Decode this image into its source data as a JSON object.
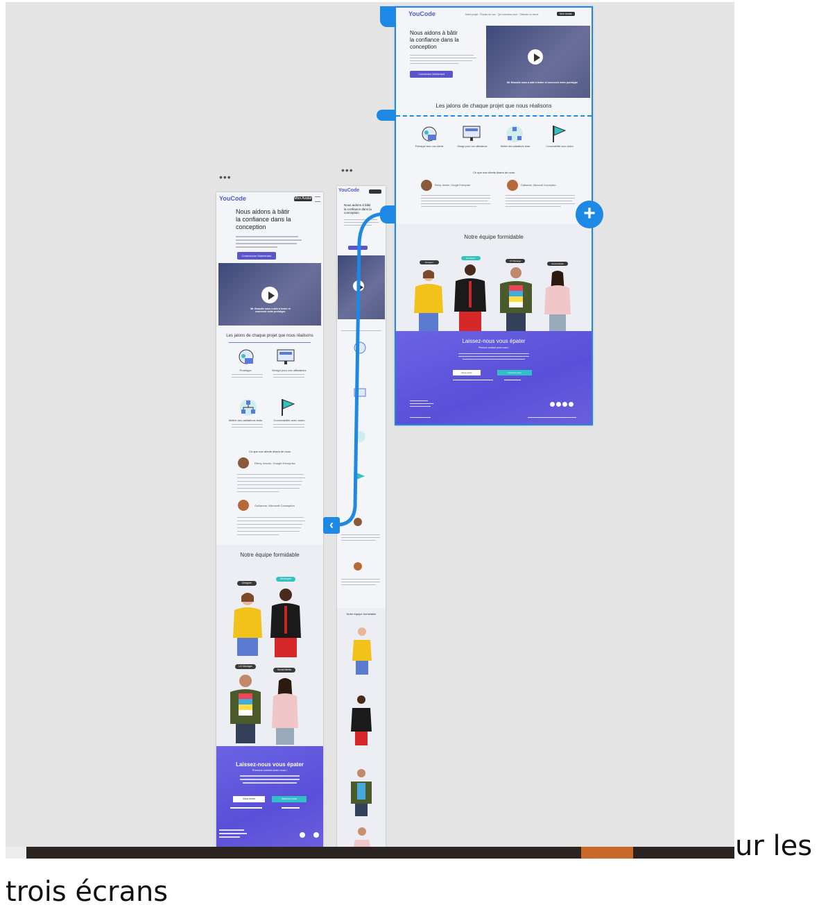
{
  "caption": {
    "line1": "ur les",
    "line2": "trois écrans"
  },
  "frame_menu_icon": "•••",
  "brand": {
    "logo": "YouCode",
    "accent": "#5a55c9",
    "teal": "#31c0c7",
    "selection": "#1e88e5"
  },
  "mobile": {
    "nav_button": "Mon Avatar",
    "hero_title": [
      "Nous aidons à bâtir",
      "la confiance dans la",
      "conception"
    ],
    "cta": "Commencer Maintenant",
    "video_caption": [
      "Mr. Beaudin nous a aidé à tester et",
      "concevoir notre prototype."
    ],
    "milestones_title": "Les jalons de chaque projet que nous réalisons",
    "features": [
      "Prototype",
      "Design pour vos utilisateurs",
      "Mettre des validations tests",
      "Concevabilité avec vision"
    ],
    "testimonials_title": "Ce que nos clients disent de nous",
    "testimonial1_name": "Rémy Janvier, Google Entreprise",
    "testimonial2_name": "Guillaume, Microsoft Conception",
    "team_title": "Notre équipe formidable",
    "team_tags": [
      "Designer",
      "Developer",
      "UX Manager",
      "Social Media"
    ],
    "cta_title": "Laissez-nous vous épater",
    "cta_subtitle": "Prenons contact avec nous !",
    "btn_primary": "Nous écrire",
    "btn_secondary": "Inscrivez-vous"
  },
  "tablet": {
    "hero_title": [
      "Nous aidons à bâtir",
      "la confiance dans la",
      "conception"
    ],
    "team_title": "Notre équipe formidable"
  },
  "desktop": {
    "nav_links": "Notre projet · Études de cas · Qui sommes-nous · Obtenez un devis",
    "nav_button": "Mon Avatar",
    "hero_title": [
      "Nous aidons à bâtir",
      "la confiance dans la",
      "conception"
    ],
    "cta": "Commencer Maintenant",
    "video_caption": "Mr. Beaudin nous a aidé à tester et concevoir notre prototype",
    "milestones_title": "Les jalons de chaque projet que nous réalisons",
    "features": [
      "Prototype avec vos clients",
      "Design pour vos utilisateurs",
      "Mettre des validations tests",
      "Concevabilité avec vision"
    ],
    "testimonials_title": "Ce que nos clients disent de nous",
    "testimonial1": "Rémy Janvier, Google Entreprise",
    "testimonial2": "Guillaume, Microsoft Conception",
    "team_title": "Notre équipe formidable",
    "team_tags": [
      "Designer",
      "Developer",
      "UX Manager",
      "Social Media"
    ],
    "cta_title": "Laissez-nous vous épater",
    "cta_subtitle": "Prenons contact avec nous !",
    "btn_primary": "Nous écrire",
    "btn_secondary": "Inscrivez-vous"
  }
}
